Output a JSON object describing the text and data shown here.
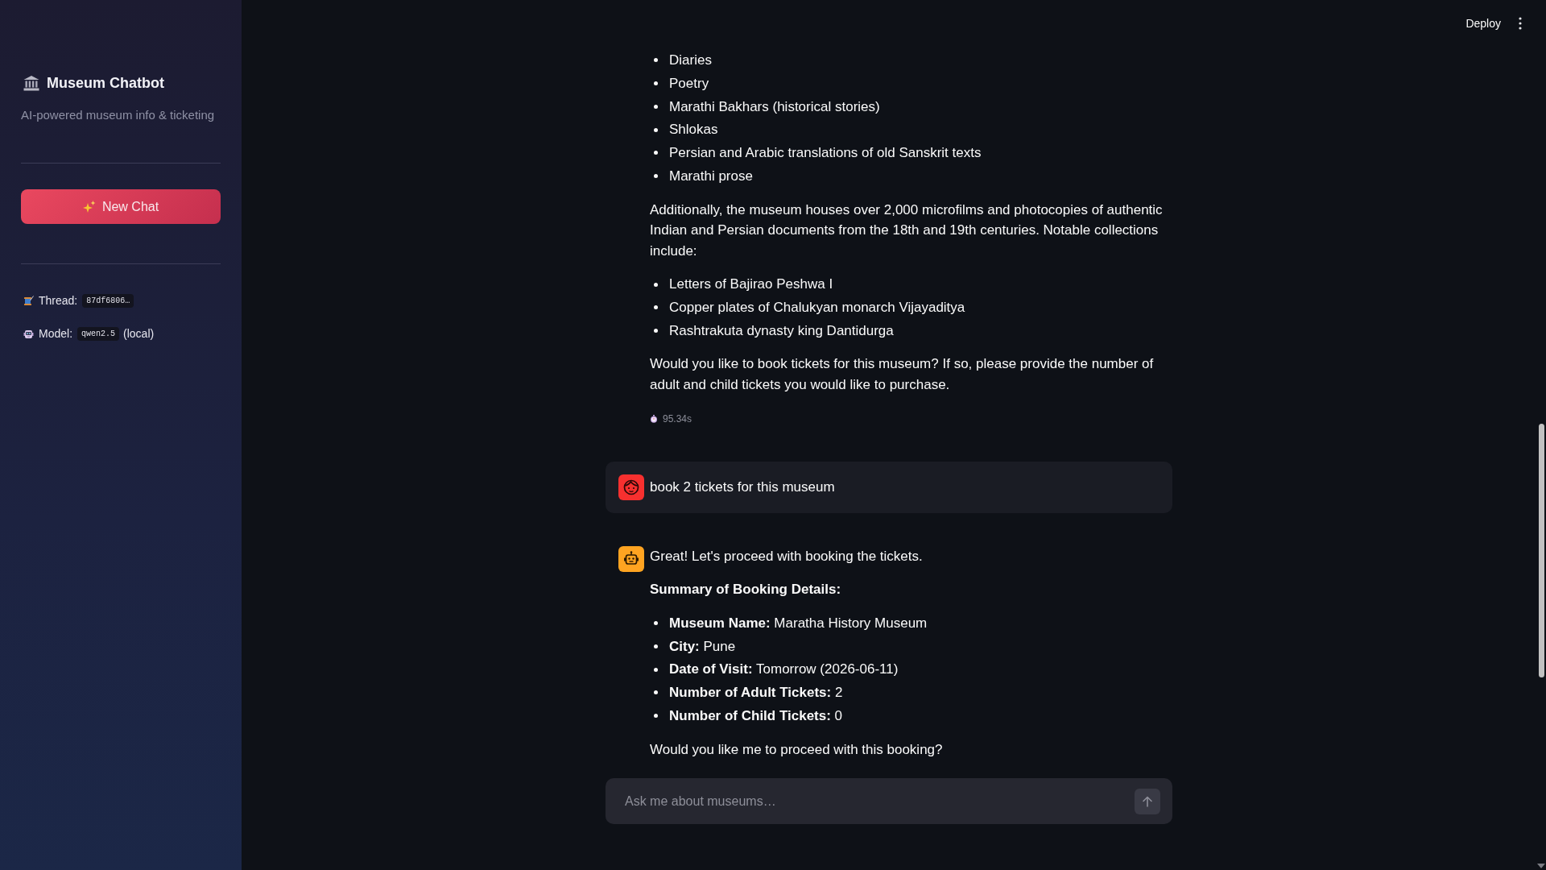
{
  "sidebar": {
    "title": "Museum Chatbot",
    "subtitle": "AI-powered museum info & ticketing",
    "new_chat_label": "New Chat",
    "info": [
      {
        "kind": "thread",
        "label": "Thread:",
        "value": "87df6806…"
      },
      {
        "kind": "model",
        "label": "Model:",
        "value": "qwen2.5",
        "suffix": "(local)"
      }
    ]
  },
  "header": {
    "deploy_label": "Deploy"
  },
  "chat": {
    "continued_reply": {
      "blocks": [
        {
          "kind": "list",
          "items": [
            "Diaries",
            "Poetry",
            "Marathi Bakhars (historical stories)",
            "Shlokas",
            "Persian and Arabic translations of old Sanskrit texts",
            "Marathi prose"
          ]
        },
        {
          "kind": "paragraph",
          "text": "Additionally, the museum houses over 2,000 microfilms and photocopies of authentic Indian and Persian documents from the 18th and 19th centuries. Notable collections include:"
        },
        {
          "kind": "list",
          "items": [
            "Letters of Bajirao Peshwa I",
            "Copper plates of Chalukyan monarch Vijayaditya",
            "Rashtrakuta dynasty king Dantidurga"
          ]
        },
        {
          "kind": "paragraph",
          "text": "Would you like to book tickets for this museum? If so, please provide the number of adult and child tickets you would like to purchase."
        }
      ],
      "elapsed": "95.34s"
    },
    "messages": [
      {
        "kind": "user",
        "text": "book 2 tickets for this museum"
      },
      {
        "kind": "assistant",
        "blocks": [
          {
            "kind": "paragraph",
            "text": "Great! Let's proceed with booking the tickets."
          },
          {
            "kind": "heading",
            "text": "Summary of Booking Details:"
          },
          {
            "kind": "list",
            "items": [
              "**Museum Name:** Maratha History Museum",
              "**City:** Pune",
              "**Date of Visit:** Tomorrow (2026-06-11)",
              "**Number of Adult Tickets:** 2",
              "**Number of Child Tickets:** 0"
            ]
          },
          {
            "kind": "paragraph",
            "text": "Would you like me to proceed with this booking?"
          }
        ]
      }
    ]
  },
  "chat_input": {
    "placeholder": "Ask me about museums…"
  }
}
